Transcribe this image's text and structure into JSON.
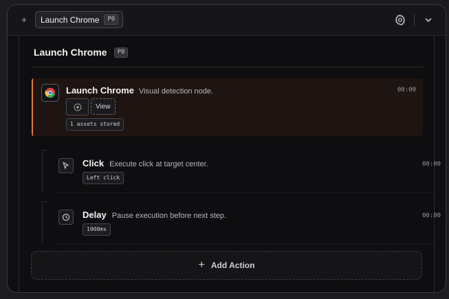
{
  "topbar": {
    "add_symbol": "+",
    "tab": {
      "label": "Launch Chrome",
      "badge": "P0"
    },
    "settings_icon": "gear-icon",
    "collapse_icon": "chevron-down-icon"
  },
  "header": {
    "title": "Launch Chrome",
    "badge": "P0"
  },
  "nodes": [
    {
      "title": "Launch Chrome",
      "description": "Visual detection node.",
      "time": "00:00",
      "view_label": "View",
      "assets_label": "1 assets stored",
      "icon": "chrome-icon",
      "accent": "#e07a3c"
    }
  ],
  "steps": [
    {
      "title": "Click",
      "description": "Execute click at target center.",
      "time": "00:00",
      "tag": "Left click",
      "icon": "cursor-icon"
    },
    {
      "title": "Delay",
      "description": "Pause execution before next step.",
      "time": "00:00",
      "tag": "1000ms",
      "icon": "clock-icon"
    }
  ],
  "add_action": {
    "label": "Add Action",
    "icon": "plus-icon"
  }
}
